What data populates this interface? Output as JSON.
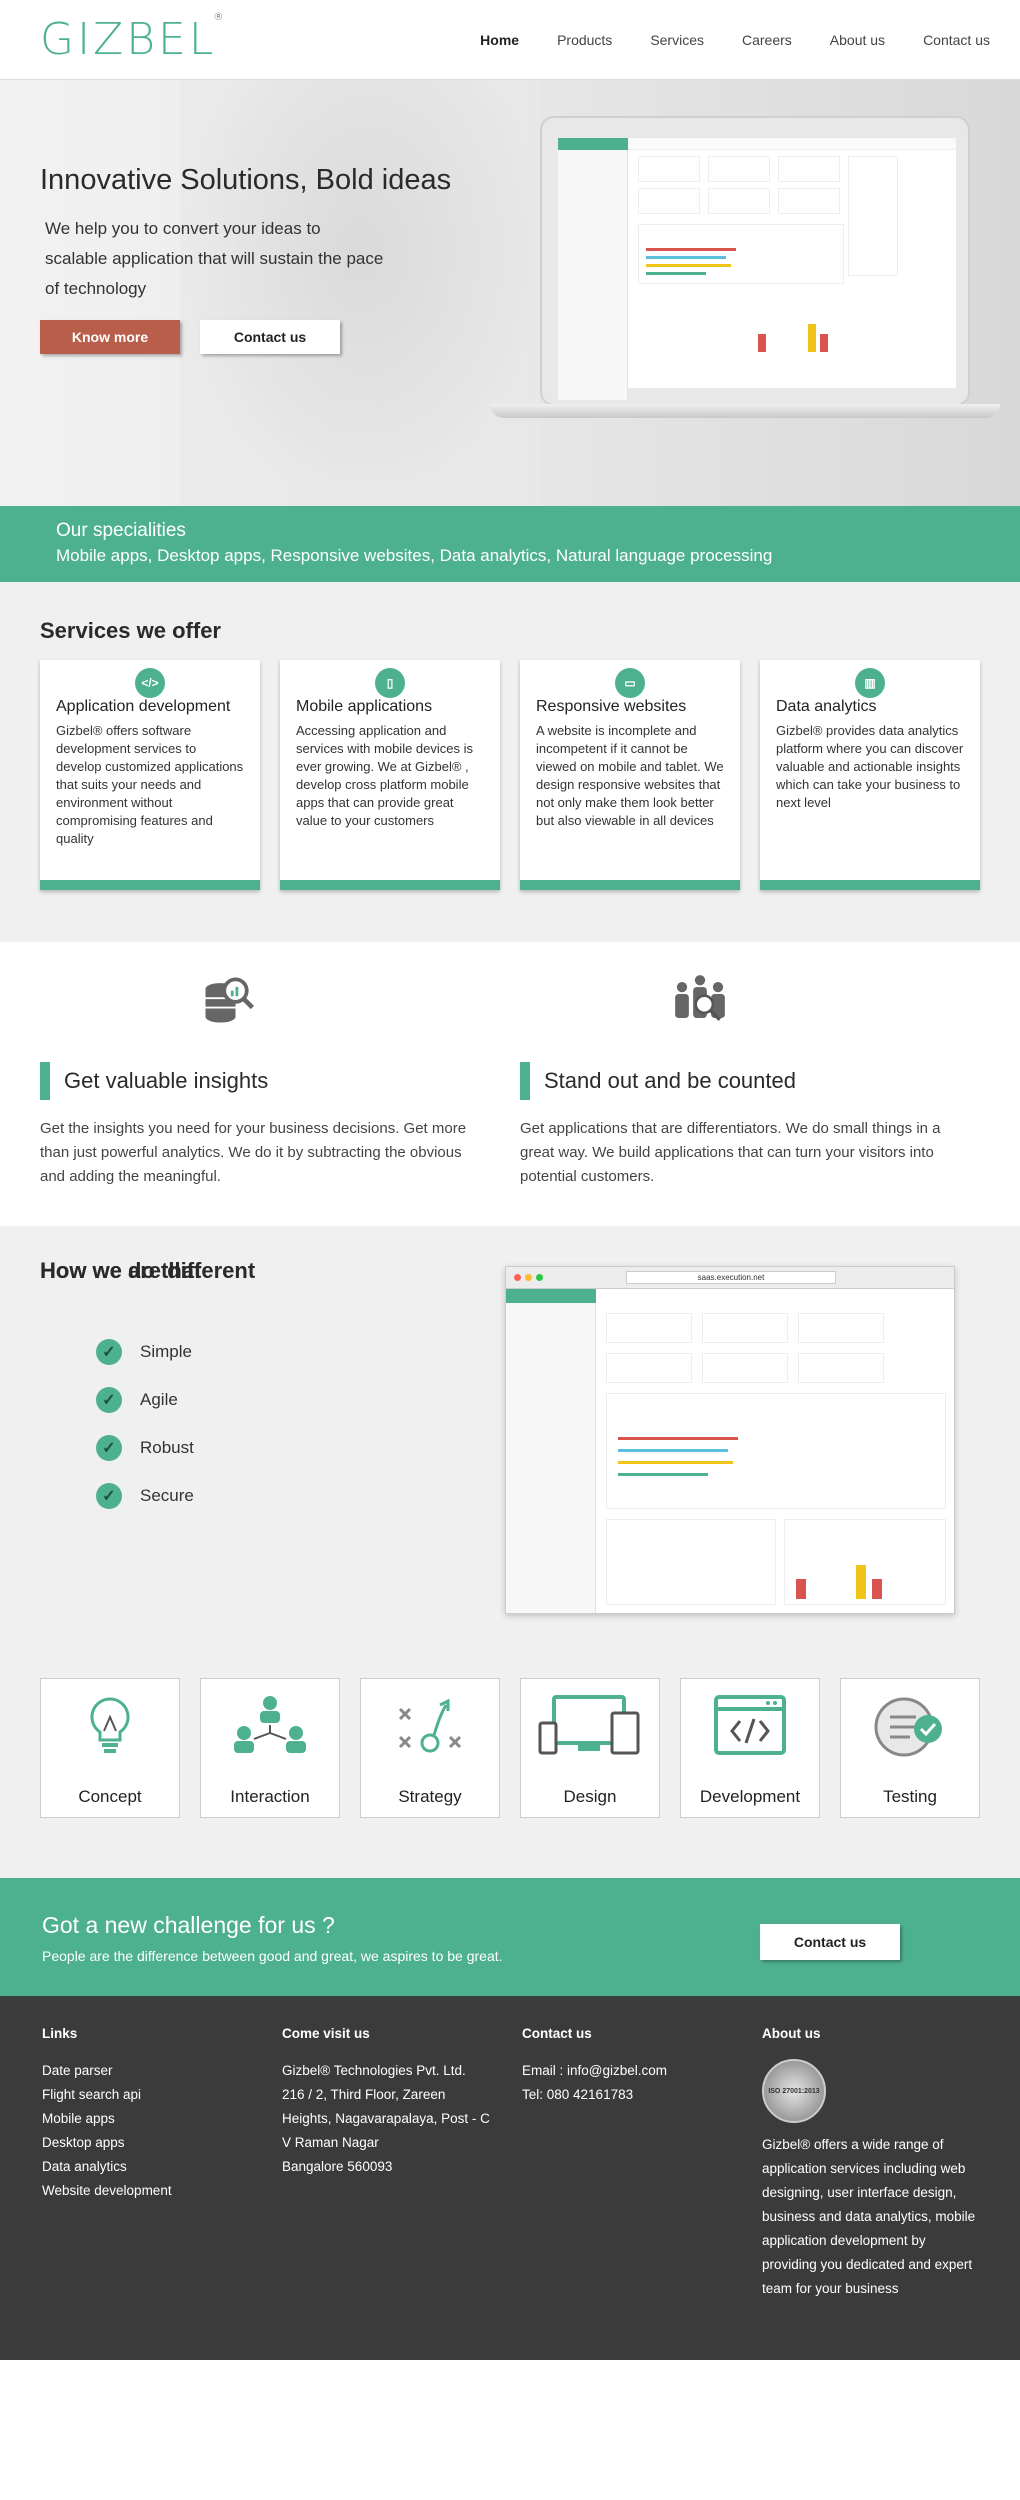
{
  "brand": {
    "logo_text": "GIZBEL",
    "logo_mark": "®",
    "accent": "#4db18f",
    "cta_red": "#b85e4a"
  },
  "nav": {
    "items": [
      "Home",
      "Products",
      "Services",
      "Careers",
      "About us",
      "Contact us"
    ]
  },
  "hero": {
    "title": "Innovative Solutions, Bold ideas",
    "subtitle": "We help you to convert your ideas to scalable application that will sustain the pace of technology",
    "know_more": "Know more",
    "contact_us": "Contact us"
  },
  "specialities": {
    "title": "Our specialities",
    "items": "Mobile apps, Desktop apps, Responsive websites, Data analytics, Natural language processing"
  },
  "services": {
    "heading": "Services we offer",
    "cards": [
      {
        "icon": "code-icon",
        "title": "Application development",
        "text": "Gizbel® offers software development services to develop customized applications that suits your needs and environment without compromising features and quality"
      },
      {
        "icon": "mobile-icon",
        "title": "Mobile applications",
        "text": "Accessing application and services with mobile devices is ever growing. We at Gizbel® , develop cross platform mobile apps that can provide great value to your customers"
      },
      {
        "icon": "monitor-icon",
        "title": "Responsive websites",
        "text": "A website is incomplete and incompetent if it cannot be viewed on mobile and tablet. We design responsive websites that not only make them look better but also viewable in all devices"
      },
      {
        "icon": "chart-icon",
        "title": "Data analytics",
        "text": "Gizbel® provides data analytics platform where you can discover valuable and actionable insights which can take your business to next level"
      }
    ]
  },
  "insights": [
    {
      "icon": "database-search-icon",
      "title": "Get valuable insights",
      "text": "Get the insights you need for your business decisions. Get more than just powerful analytics. We do it by subtracting the obvious and adding the meaningful."
    },
    {
      "icon": "people-search-icon",
      "title": "Stand out and be counted",
      "text": "Get applications that are differentiators. We do small things in a great way. We build applications that can turn your visitors into potential customers."
    }
  ],
  "different": {
    "heading": "How we are different",
    "items": [
      "Simple",
      "Agile",
      "Robust",
      "Secure"
    ],
    "browser_url": "saas.execution.net"
  },
  "howdo": {
    "heading": "How we do that",
    "steps": [
      {
        "icon": "bulb-icon",
        "label": "Concept"
      },
      {
        "icon": "network-icon",
        "label": "Interaction"
      },
      {
        "icon": "strategy-icon",
        "label": "Strategy"
      },
      {
        "icon": "devices-icon",
        "label": "Design"
      },
      {
        "icon": "code-window-icon",
        "label": "Development"
      },
      {
        "icon": "checklist-icon",
        "label": "Testing"
      }
    ]
  },
  "cta": {
    "title": "Got a new challenge for us ?",
    "text": "People are the difference between good and great, we aspires to be great.",
    "button": "Contact us"
  },
  "footer": {
    "links": {
      "title": "Links",
      "items": [
        "Date parser",
        "Flight search api",
        "Mobile apps",
        "Desktop apps",
        "Data analytics",
        "Website development"
      ]
    },
    "visit": {
      "title": "Come visit us",
      "lines": [
        "Gizbel® Technologies Pvt. Ltd.",
        "216 / 2, Third Floor, Zareen",
        "Heights, Nagavarapalaya, Post - C",
        "V Raman Nagar",
        "Bangalore 560093"
      ]
    },
    "contact": {
      "title": "Contact us",
      "email": "Email : info@gizbel.com",
      "tel": "Tel: 080 42161783"
    },
    "about": {
      "title": "About us",
      "badge": "ISO 27001:2013",
      "text": "Gizbel® offers a wide range of application services including web designing, user interface design, business and data analytics, mobile application development by providing you dedicated and expert team for your business"
    }
  }
}
